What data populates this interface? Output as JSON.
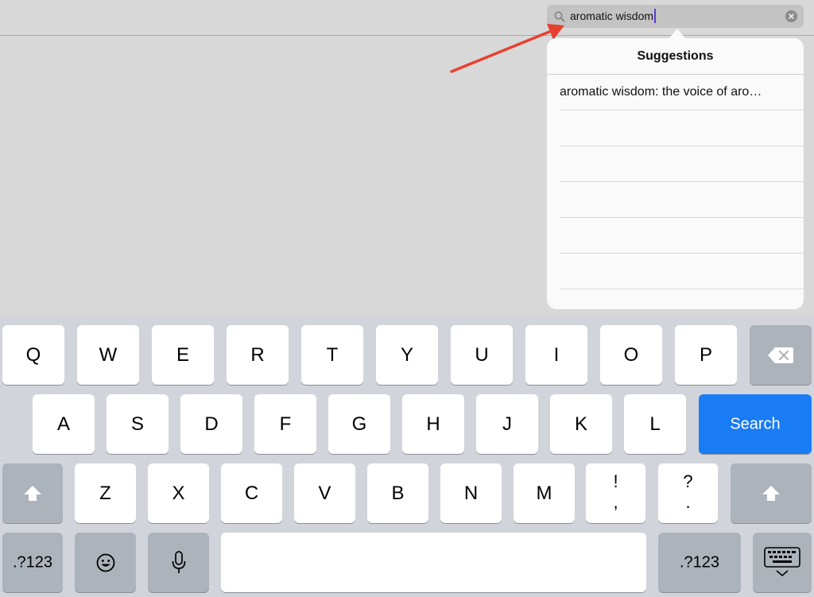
{
  "search": {
    "value": "aromatic wisdom"
  },
  "suggestions": {
    "title": "Suggestions",
    "items": [
      "aromatic wisdom: the voice of aro…",
      "",
      "",
      "",
      "",
      ""
    ]
  },
  "keyboard": {
    "row1": [
      "Q",
      "W",
      "E",
      "R",
      "T",
      "Y",
      "U",
      "I",
      "O",
      "P"
    ],
    "row2": [
      "A",
      "S",
      "D",
      "F",
      "G",
      "H",
      "J",
      "K",
      "L"
    ],
    "row3": [
      "Z",
      "X",
      "C",
      "V",
      "B",
      "N",
      "M"
    ],
    "punct1": {
      "top": "!",
      "bottom": ","
    },
    "punct2": {
      "top": "?",
      "bottom": "."
    },
    "search_label": "Search",
    "numbers_left": ".?123",
    "numbers_right": ".?123"
  },
  "colors": {
    "accent": "#1a7cf5",
    "annotation_arrow": "#e8402f",
    "caret": "#5b3bd6"
  },
  "icons": {
    "search": "magnifier-icon",
    "clear": "clear-icon",
    "delete": "backspace-icon",
    "shift": "shift-icon",
    "emoji": "emoji-icon",
    "mic": "microphone-icon",
    "dismiss": "keyboard-dismiss-icon"
  }
}
